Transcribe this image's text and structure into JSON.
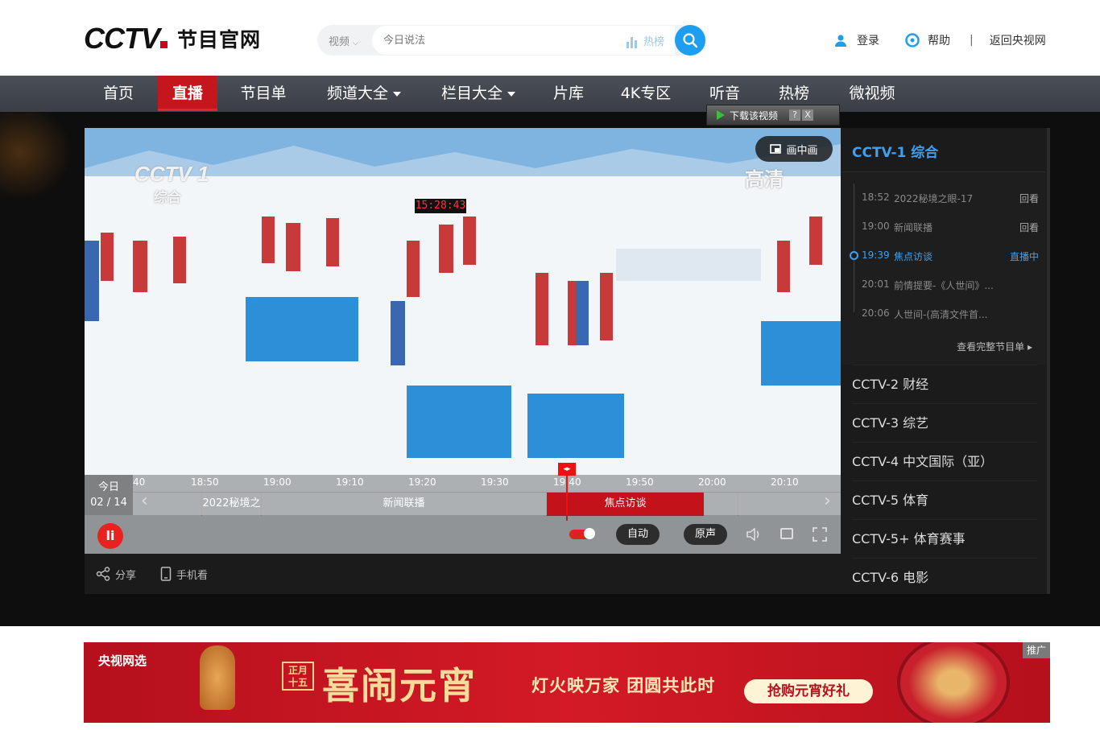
{
  "header": {
    "logo_text": "CCTV",
    "logo_sub": "节目官网",
    "search": {
      "category": "视频",
      "placeholder": "今日说法",
      "hot_label": "热榜"
    },
    "links": {
      "login": "登录",
      "help": "帮助",
      "back": "返回央视网"
    }
  },
  "nav": {
    "items": [
      {
        "label": "首页"
      },
      {
        "label": "直播"
      },
      {
        "label": "节目单"
      },
      {
        "label": "频道大全"
      },
      {
        "label": "栏目大全"
      },
      {
        "label": "片库"
      },
      {
        "label": "4K专区"
      },
      {
        "label": "听音"
      },
      {
        "label": "热榜"
      },
      {
        "label": "微视频"
      }
    ]
  },
  "download_bar": {
    "label": "下载该视频",
    "help": "?",
    "close": "X"
  },
  "player": {
    "pip_label": "画中画",
    "watermark_logo": "CCTV 1",
    "watermark_sub": "综合",
    "watermark_hd": "高清",
    "race_clock": "15:28:43",
    "timeline": {
      "day_label": "今日",
      "date": "02 / 14",
      "ticks": [
        "40",
        "18:50",
        "19:00",
        "19:10",
        "19:20",
        "19:30",
        "19:40",
        "19:50",
        "20:00",
        "20:10"
      ],
      "programs": [
        {
          "title": "2022秘境之"
        },
        {
          "title": "新闻联播"
        },
        {
          "title": "焦点访谈"
        },
        {
          "title": ""
        }
      ]
    },
    "controls": {
      "logo": "li",
      "auto_label": "自动",
      "original_label": "原声"
    }
  },
  "under": {
    "share": "分享",
    "mobile": "手机看"
  },
  "sidebar": {
    "current_channel": "CCTV-1 综合",
    "schedule": [
      {
        "time": "18:52",
        "title": "2022秘境之眼-17",
        "status": "回看"
      },
      {
        "time": "19:00",
        "title": "新闻联播",
        "status": "回看"
      },
      {
        "time": "19:39",
        "title": "焦点访谈",
        "status": "直播中"
      },
      {
        "time": "20:01",
        "title": "前情提要-《人世间》...",
        "status": ""
      },
      {
        "time": "20:06",
        "title": "人世间-(高清文件首...",
        "status": ""
      }
    ],
    "more_label": "查看完整节目单",
    "channels": [
      {
        "label": "CCTV-2 财经"
      },
      {
        "label": "CCTV-3 综艺"
      },
      {
        "label": "CCTV-4 中文国际（亚）"
      },
      {
        "label": "CCTV-5 体育"
      },
      {
        "label": "CCTV-5+ 体育赛事"
      },
      {
        "label": "CCTV-6 电影"
      }
    ]
  },
  "banner": {
    "brand": "央视网选",
    "date_line1": "正月",
    "date_line2": "十五",
    "title": "喜闹元宵",
    "slogan": "灯火映万家 团圆共此时",
    "cta": "抢购元宵好礼",
    "ad_tag": "推广"
  },
  "colors": {
    "accent_red": "#c4161c",
    "accent_blue": "#1e9ef0",
    "nav_bg": "#45484f"
  }
}
